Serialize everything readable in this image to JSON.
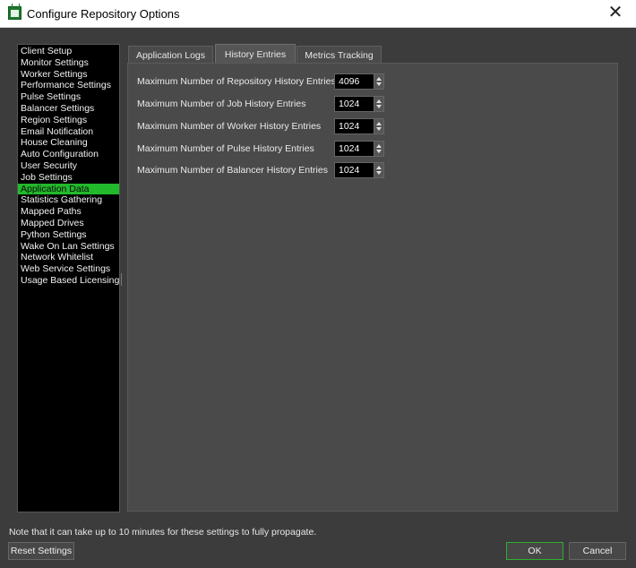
{
  "window": {
    "title": "Configure Repository Options",
    "close_glyph": "✕"
  },
  "sidebar": {
    "items": [
      {
        "label": "Client Setup"
      },
      {
        "label": "Monitor Settings"
      },
      {
        "label": "Worker Settings"
      },
      {
        "label": "Performance Settings"
      },
      {
        "label": "Pulse Settings"
      },
      {
        "label": "Balancer Settings"
      },
      {
        "label": "Region Settings"
      },
      {
        "label": "Email Notification"
      },
      {
        "label": "House Cleaning"
      },
      {
        "label": "Auto Configuration"
      },
      {
        "label": "User Security"
      },
      {
        "label": "Job Settings"
      },
      {
        "label": "Application Data",
        "selected": true
      },
      {
        "label": "Statistics Gathering"
      },
      {
        "label": "Mapped Paths"
      },
      {
        "label": "Mapped Drives"
      },
      {
        "label": "Python Settings"
      },
      {
        "label": "Wake On Lan Settings"
      },
      {
        "label": "Network Whitelist"
      },
      {
        "label": "Web Service Settings"
      },
      {
        "label": "Usage Based Licensing"
      }
    ],
    "selected_color": "#22b92c"
  },
  "tabs": [
    {
      "label": "Application Logs"
    },
    {
      "label": "History Entries",
      "active": true
    },
    {
      "label": "Metrics Tracking"
    }
  ],
  "history_entries": {
    "fields": [
      {
        "label": "Maximum Number of Repository History Entries",
        "value": "4096"
      },
      {
        "label": "Maximum Number of Job History Entries",
        "value": "1024"
      },
      {
        "label": "Maximum Number of Worker History Entries",
        "value": "1024"
      },
      {
        "label": "Maximum Number of Pulse History Entries",
        "value": "1024"
      },
      {
        "label": "Maximum Number of Balancer History Entries",
        "value": "1024"
      }
    ]
  },
  "footer": {
    "note": "Note that it can take up to 10 minutes for these settings to fully propagate.",
    "reset_label": "Reset Settings",
    "ok_label": "OK",
    "cancel_label": "Cancel"
  }
}
